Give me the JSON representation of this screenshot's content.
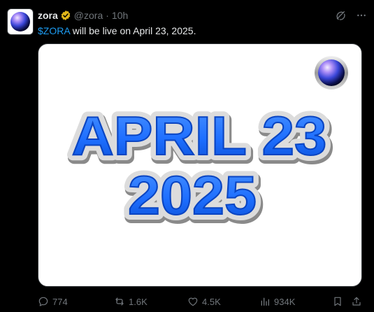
{
  "post": {
    "author": {
      "display_name": "zora",
      "handle": "@zora",
      "separator": "·",
      "time_ago": "10h",
      "verified_badge_icon": "gold-verified-badge-icon"
    },
    "text": {
      "cashtag": "$ZORA",
      "body": " will be live on April 23, 2025."
    },
    "media": {
      "line1": "APRIL 23",
      "line2": "2025",
      "text_color": "#1e6fff",
      "orb_icon": "zora-orb-logo"
    },
    "header_actions": {
      "grok_icon": "grok-icon",
      "more_icon": "more-icon"
    },
    "stats": {
      "replies": "774",
      "reposts": "1.6K",
      "likes": "4.5K",
      "views": "934K"
    }
  },
  "colors": {
    "background": "#000000",
    "text_primary": "#e7e9ea",
    "text_secondary": "#71767b",
    "link": "#1d9bf0",
    "verified_gold": "#e2b719"
  }
}
